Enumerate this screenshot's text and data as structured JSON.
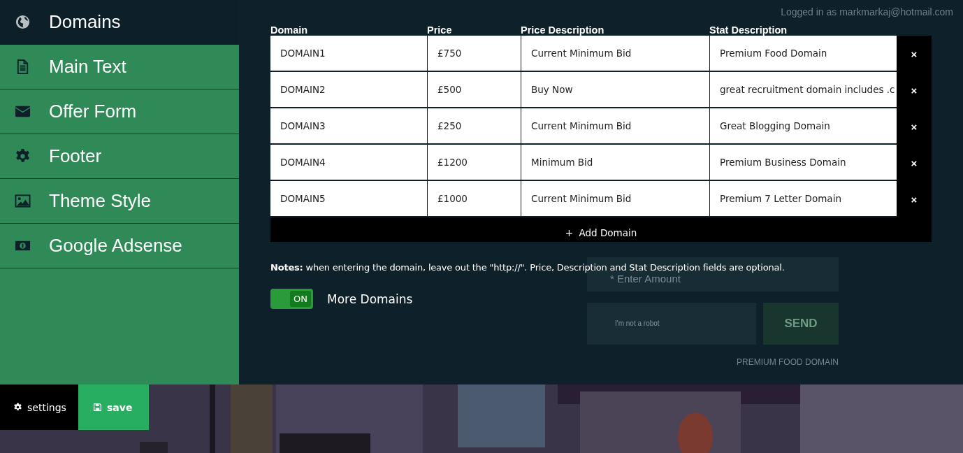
{
  "sidebar": {
    "items": [
      {
        "label": "Domains",
        "selected": true
      },
      {
        "label": "Main Text",
        "selected": false
      },
      {
        "label": "Offer Form",
        "selected": false
      },
      {
        "label": "Footer",
        "selected": false
      },
      {
        "label": "Theme Style",
        "selected": false
      },
      {
        "label": "Google Adsense",
        "selected": false
      }
    ]
  },
  "logged_in": "Logged in as markmarkaj@hotmail.com",
  "table": {
    "columns": [
      "Domain",
      "Price",
      "Price Description",
      "Stat Description"
    ],
    "rows": [
      {
        "cells": [
          "DOMAIN1",
          "£750",
          "Current Minimum Bid",
          "Premium Food Domain"
        ],
        "remove": "×"
      },
      {
        "cells": [
          "DOMAIN2",
          "£500",
          "Buy Now",
          "great recruitment domain includes .c"
        ],
        "remove": "×"
      },
      {
        "cells": [
          "DOMAIN3",
          "£250",
          "Current Minimum Bid",
          "Great Blogging Domain"
        ],
        "remove": "×"
      },
      {
        "cells": [
          "DOMAIN4",
          "£1200",
          "Minimum Bid",
          "Premium Business Domain"
        ],
        "remove": "×"
      },
      {
        "cells": [
          "DOMAIN5",
          "£1000",
          "Current Minimum Bid",
          "Premium 7 Letter Domain"
        ],
        "remove": "×"
      }
    ]
  },
  "add_button": {
    "icon": "+",
    "label": "Add Domain"
  },
  "notes": "**Notes:** when entering the domain, leave out the \"http://\". Price, Description and Stat Description fields are optional.",
  "toggle": {
    "on": true,
    "label": "ON",
    "caption": "More Domains"
  },
  "background_form": {
    "amount_placeholder": "* Enter Amount",
    "captcha": "I'm not a robot",
    "send": "SEND",
    "caption": "PREMIUM FOOD DOMAIN"
  },
  "footer_buttons": [
    {
      "kind": "settings",
      "label": "settings"
    },
    {
      "kind": "save",
      "label": "save"
    }
  ]
}
